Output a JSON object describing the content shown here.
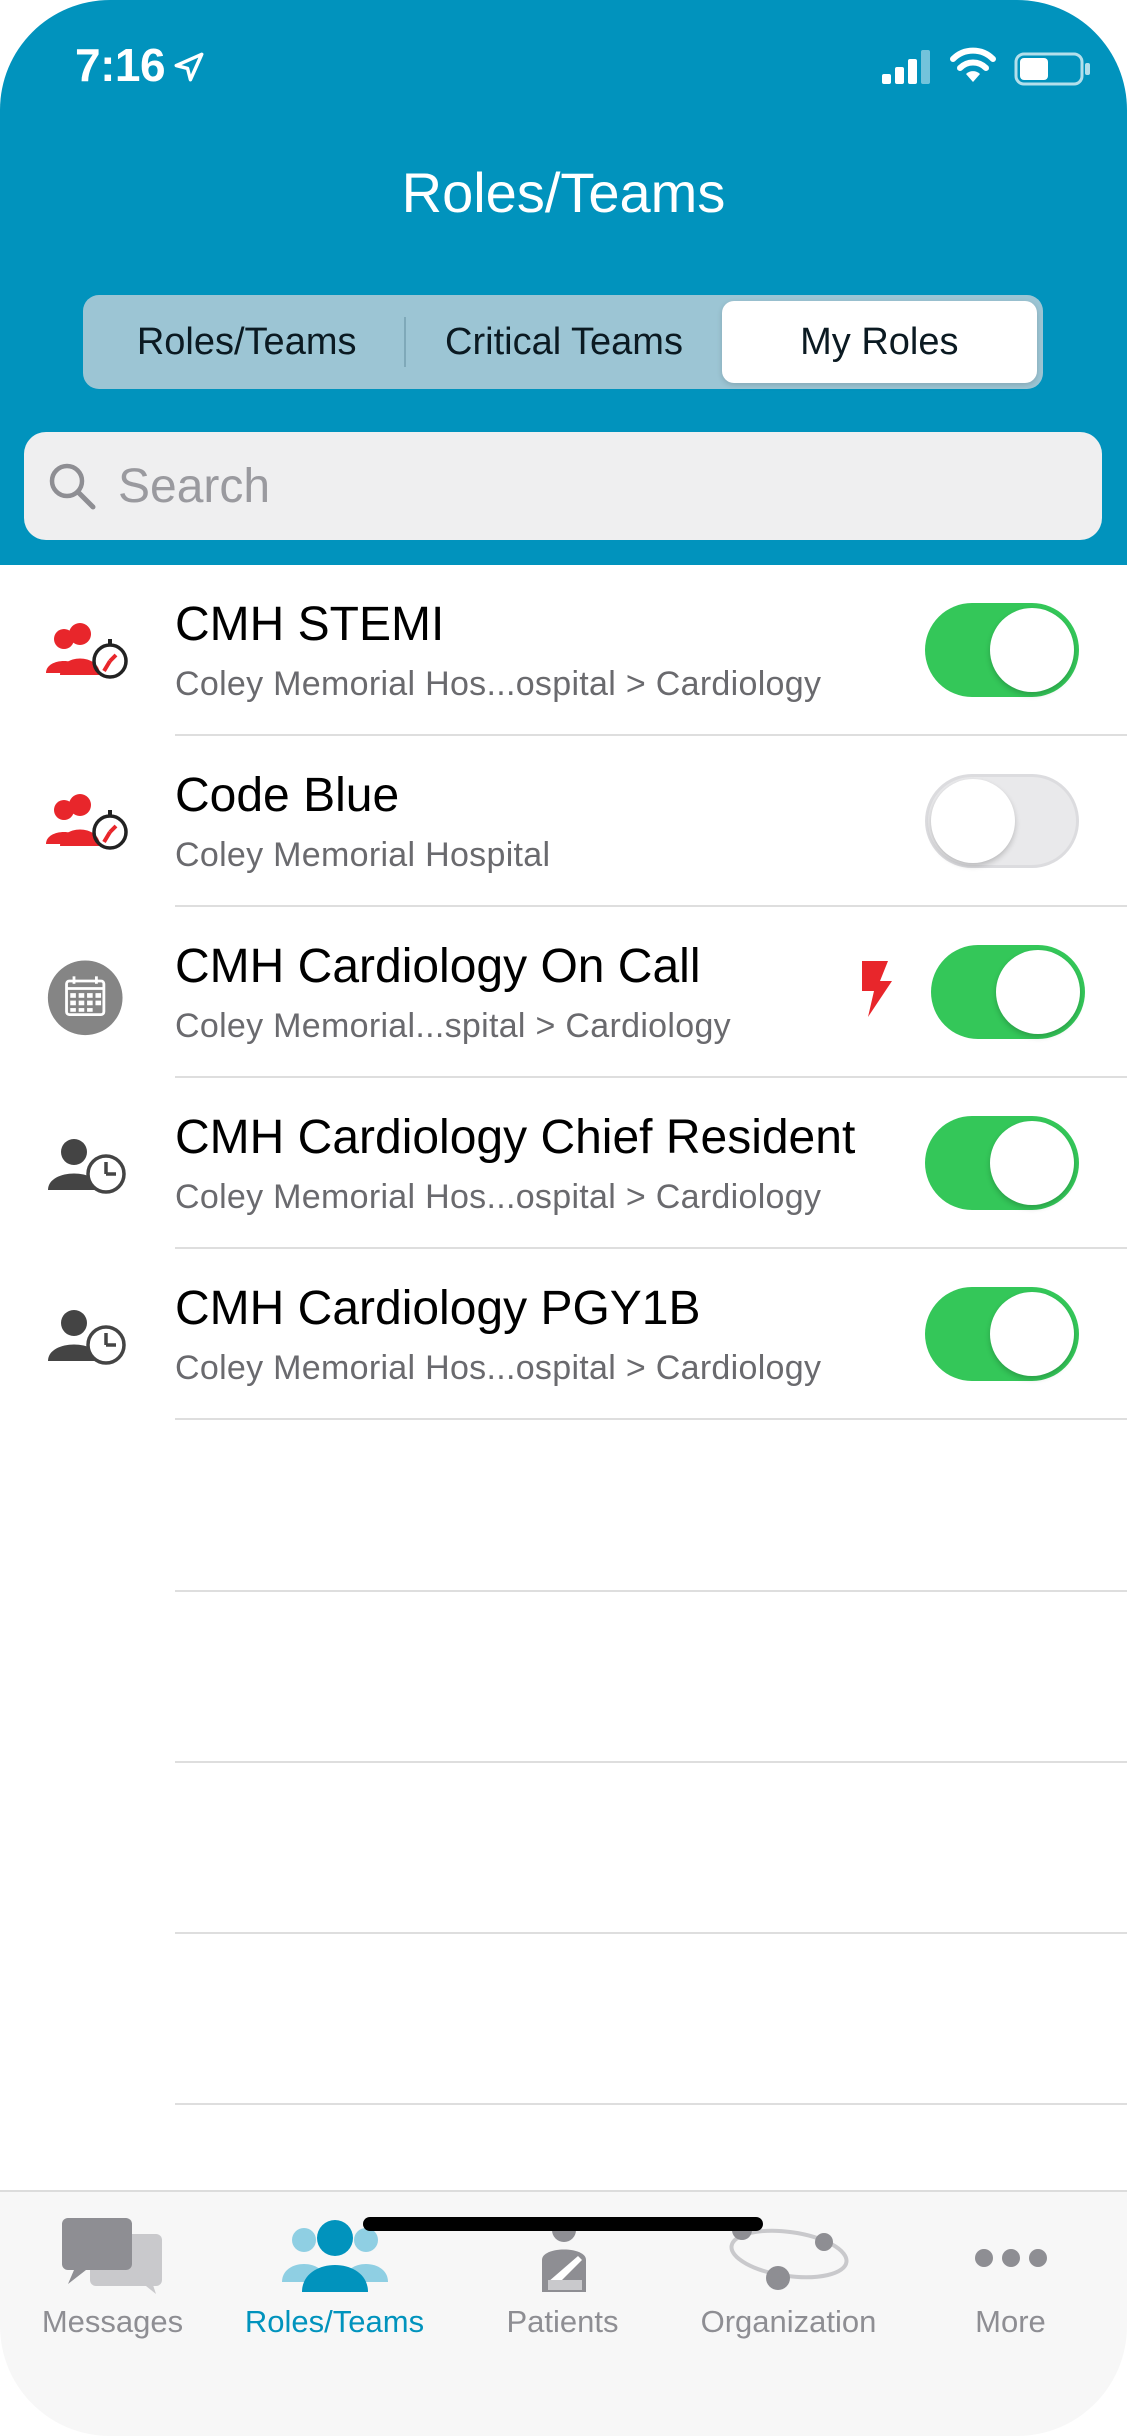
{
  "colors": {
    "brand": "#0193bd",
    "toggle_on": "#34c759",
    "alert_red": "#e8262b"
  },
  "status_bar": {
    "time": "7:16"
  },
  "header": {
    "title": "Roles/Teams"
  },
  "segments": [
    {
      "label": "Roles/Teams",
      "active": false
    },
    {
      "label": "Critical Teams",
      "active": false
    },
    {
      "label": "My Roles",
      "active": true
    }
  ],
  "search": {
    "placeholder": "Search"
  },
  "roles": [
    {
      "title": "CMH STEMI",
      "subtitle": "Coley Memorial Hos...ospital > Cardiology",
      "icon": "critical-team-icon",
      "enabled": true,
      "alert": false
    },
    {
      "title": "Code Blue",
      "subtitle": "Coley Memorial Hospital",
      "icon": "critical-team-icon",
      "enabled": false,
      "alert": false
    },
    {
      "title": "CMH Cardiology On Call",
      "subtitle": "Coley Memorial...spital > Cardiology",
      "icon": "calendar-icon",
      "enabled": true,
      "alert": true
    },
    {
      "title": "CMH Cardiology Chief Resident",
      "subtitle": "Coley Memorial Hos...ospital > Cardiology",
      "icon": "role-clock-icon",
      "enabled": true,
      "alert": false
    },
    {
      "title": "CMH Cardiology PGY1B",
      "subtitle": "Coley Memorial Hos...ospital > Cardiology",
      "icon": "role-clock-icon",
      "enabled": true,
      "alert": false
    }
  ],
  "tabbar": [
    {
      "label": "Messages",
      "icon": "messages-icon",
      "active": false
    },
    {
      "label": "Roles/Teams",
      "icon": "roles-teams-icon",
      "active": true
    },
    {
      "label": "Patients",
      "icon": "patients-icon",
      "active": false
    },
    {
      "label": "Organization",
      "icon": "organization-icon",
      "active": false
    },
    {
      "label": "More",
      "icon": "more-icon",
      "active": false
    }
  ]
}
